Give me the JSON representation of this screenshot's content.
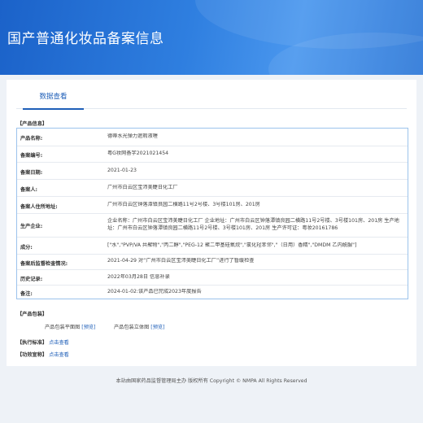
{
  "header": {
    "title": "国产普通化妆品备案信息"
  },
  "tabs": [
    {
      "label": "数据查看"
    }
  ],
  "info_section": {
    "label": "【产品信息】",
    "rows": [
      {
        "key": "产品名称:",
        "value": "德蒂水光弹力遮瑕液喱"
      },
      {
        "key": "备案编号:",
        "value": "粤G妆网备字2021021454"
      },
      {
        "key": "备案日期:",
        "value": "2021-01-23"
      },
      {
        "key": "备案人:",
        "value": "广州市白云区宝沛美睫日化工厂"
      },
      {
        "key": "备案人住所地址:",
        "value": "广州市白云区钟落潭镇良园二横路11号2号楼、3号楼101房、201房"
      },
      {
        "key": "生产企业:",
        "value": "企业名称：广州市白云区宝沛美睫日化工厂 企业地址：广州市白云区钟落潭镇良园二横路11号2号楼、3号楼101房、201房 生产地址：广州市白云区钟落潭镇良园二横路11号2号楼、3号楼101房、201房 生产许可证：粤妆20161786"
      },
      {
        "key": "成分:",
        "value": "[\"水\",\"PVP/VA 共聚物\",\"丙二醇\",\"PEG-12 聚二甲基硅氧烷\",\"氯化羟苯邻\",\"（日用）香精\",\"DMDM 乙内酰脲\"]"
      },
      {
        "key": "备案后监督检查情况:",
        "value": "2021-04-29 对“广州市白云区宝沛美睫日化工厂”进行了暂缓检查"
      },
      {
        "key": "历史记录:",
        "value": "2022年03月28日 信息补录"
      },
      {
        "key": "备注:",
        "value": "2024-01-02:该产品已完成2023年度报告"
      }
    ]
  },
  "packaging": {
    "label": "【产品包装】",
    "items": [
      {
        "label": "产品包装平面图",
        "link": "[预览]"
      },
      {
        "label": "产品包装立体图",
        "link": "[预览]"
      }
    ]
  },
  "standard": {
    "label": "【执行标准】",
    "link": "点击查看"
  },
  "efficacy": {
    "label": "【功效宣称】",
    "link": "点击查看"
  },
  "footer": {
    "text": "本站由国家药品监督管理局主办 版权所有 Copyright © NMPA All Rights Reserved"
  }
}
